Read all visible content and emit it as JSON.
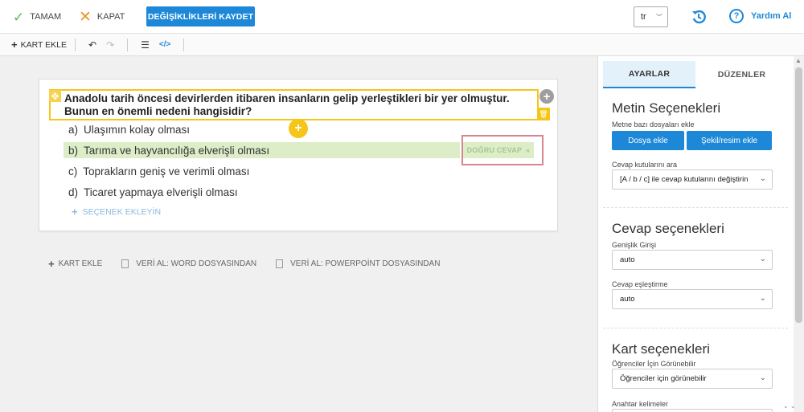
{
  "topbar": {
    "ok_label": "TAMAM",
    "close_label": "KAPAT",
    "save_label": "DEĞİŞİKLİKLERİ KAYDET",
    "language": "tr",
    "help_label": "Yardım Al"
  },
  "toolbar": {
    "add_card_label": "KART EKLE"
  },
  "question": {
    "text": "Anadolu tarih öncesi devirlerden itibaren insanların gelip yerleştikleri bir yer olmuştur. Bunun en önemli nedeni hangisidir?",
    "options": [
      {
        "letter": "a)",
        "text": "Ulaşımın kolay olması"
      },
      {
        "letter": "b)",
        "text": "Tarıma ve hayvancılığa elverişli olması"
      },
      {
        "letter": "c)",
        "text": "Toprakların geniş ve verimli olması"
      },
      {
        "letter": "d)",
        "text": "Ticaret yapmaya elverişli olması"
      }
    ],
    "correct_label": "DOĞRU CEVAP",
    "add_option_label": "SEÇENEK EKLEYİN"
  },
  "bottom_links": {
    "add_card": "KART EKLE",
    "import_word": "VERİ AL: WORD DOSYASINDAN",
    "import_ppt": "VERİ AL: POWERPOİNT DOSYASINDAN"
  },
  "panel": {
    "tabs": [
      "AYARLAR",
      "DÜZENLER"
    ],
    "text_options": {
      "title": "Metin Seçenekleri",
      "file_label": "Metne bazı dosyaları ekle",
      "file_button": "Dosya ekle",
      "image_button": "Şekil/resim ekle",
      "answer_box_label": "Cevap kutularını ara",
      "answer_box_value": "[A / b / c] ile cevap kutularını değiştirin"
    },
    "answer_options": {
      "title": "Cevap seçenekleri",
      "width_label": "Genişlik Girişi",
      "width_value": "auto",
      "match_label": "Cevap eşleştirme",
      "match_value": "auto"
    },
    "card_options": {
      "title": "Kart seçenekleri",
      "visible_label": "Öğrenciler İçin Görünebilir",
      "visible_value": "Öğrenciler için görünebilir",
      "keywords_label": "Anahtar kelimeler"
    }
  },
  "colors": {
    "accent": "#1e88d8",
    "question_border": "#f5c518",
    "correct_bg": "#dcedc8",
    "highlight_outline": "#d9858e"
  }
}
